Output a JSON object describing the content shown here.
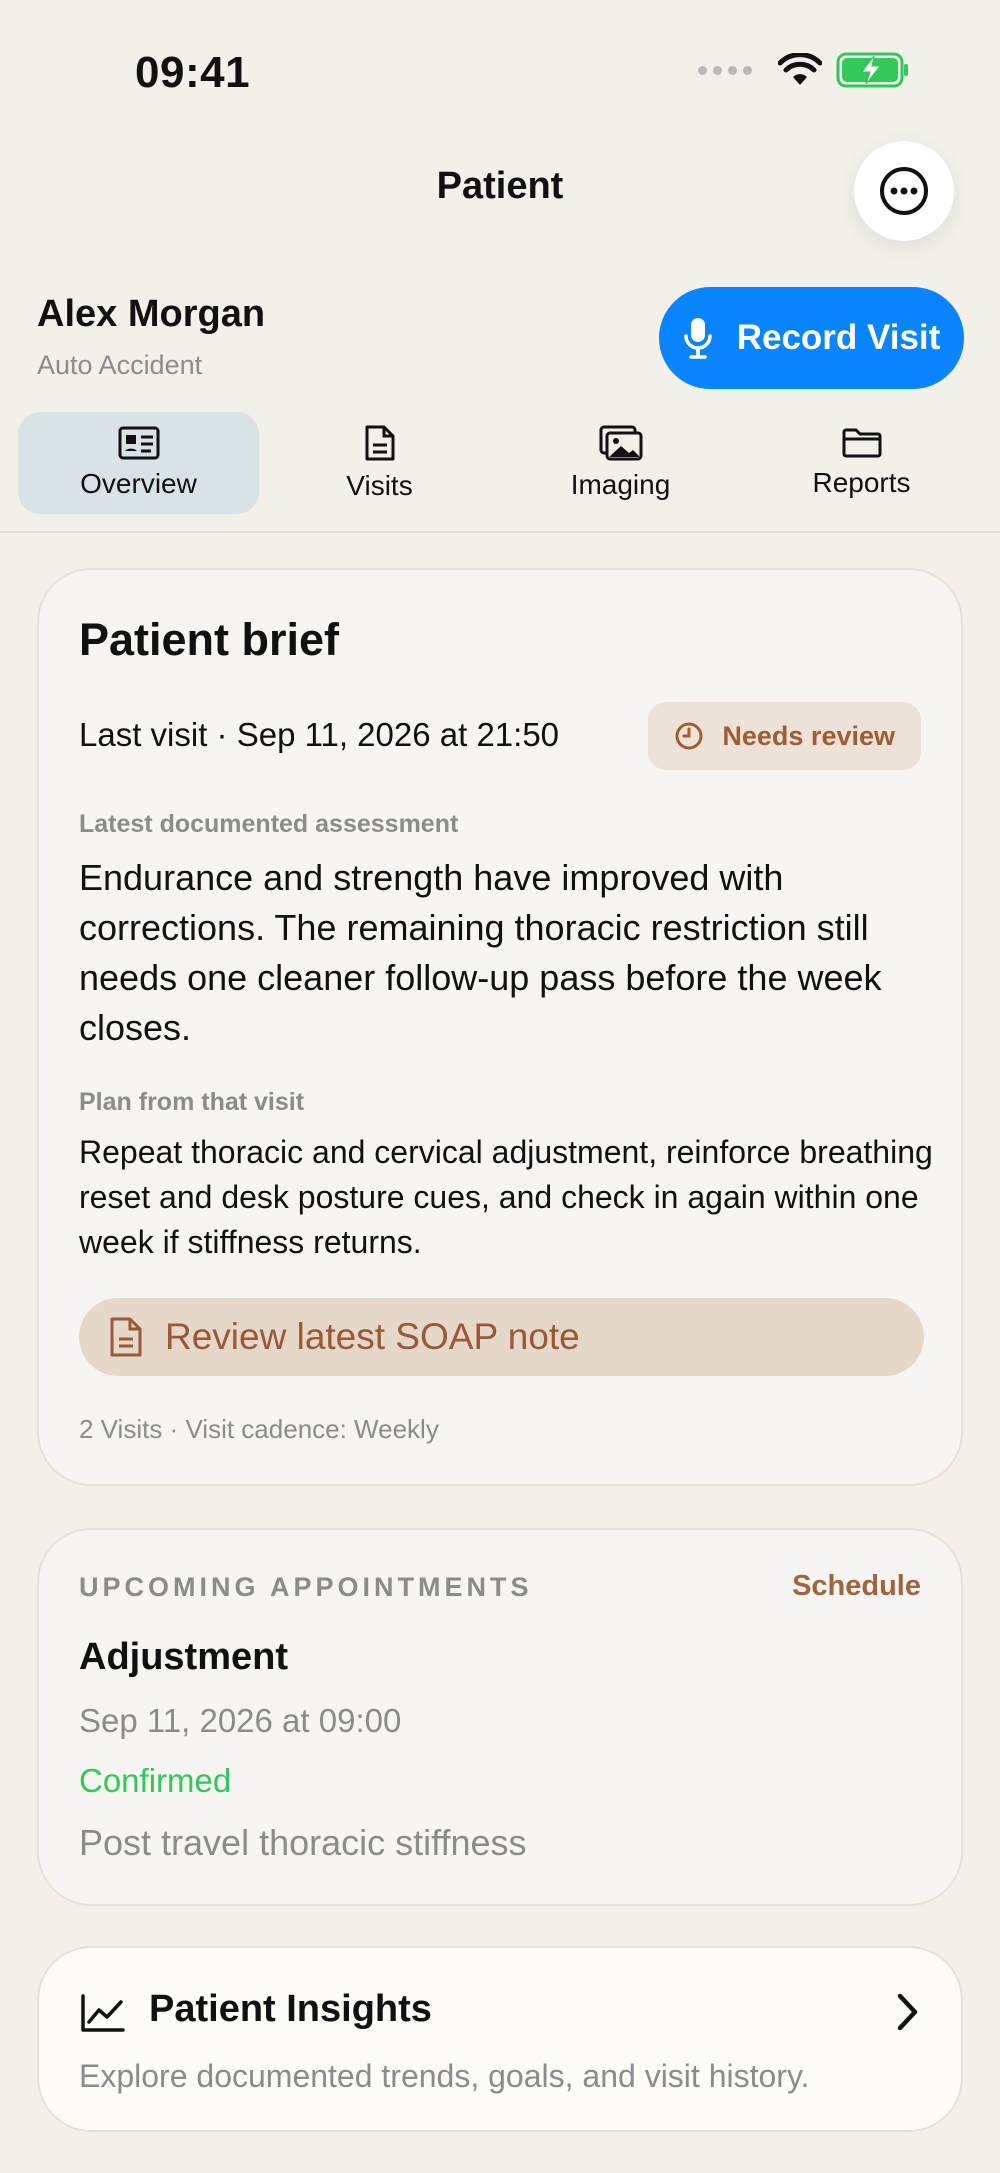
{
  "status_bar": {
    "time": "09:41"
  },
  "header": {
    "title": "Patient"
  },
  "patient": {
    "name": "Alex Morgan",
    "case_type": "Auto Accident"
  },
  "record_button": {
    "label": "Record Visit"
  },
  "tabs": [
    {
      "label": "Overview",
      "icon": "id-card-icon",
      "active": true
    },
    {
      "label": "Visits",
      "icon": "document-icon",
      "active": false
    },
    {
      "label": "Imaging",
      "icon": "images-icon",
      "active": false
    },
    {
      "label": "Reports",
      "icon": "folder-icon",
      "active": false
    }
  ],
  "brief": {
    "title": "Patient brief",
    "last_visit": "Last visit · Sep 11, 2026 at 21:50",
    "badge": "Needs review",
    "assessment_label": "Latest documented assessment",
    "assessment": "Endurance and strength have improved with corrections. The remaining thoracic restriction still needs one cleaner follow-up pass before the week closes.",
    "plan_label": "Plan from that visit",
    "plan": "Repeat thoracic and cervical adjustment, reinforce breathing reset and desk posture cues, and check in again within one week if stiffness returns.",
    "soap_button": "Review latest SOAP note",
    "meta": "2 Visits · Visit cadence: Weekly"
  },
  "appointments": {
    "title": "UPCOMING APPOINTMENTS",
    "schedule_label": "Schedule",
    "type": "Adjustment",
    "date": "Sep 11, 2026 at 09:00",
    "status": "Confirmed",
    "reason": "Post travel thoracic stiffness"
  },
  "insights": {
    "title": "Patient Insights",
    "subtitle": "Explore documented trends, goals, and visit history."
  },
  "colors": {
    "accent_blue": "#0a84ff",
    "review_brown": "#a05c35",
    "confirmed_green": "#34c759",
    "background": "#f3efe9"
  }
}
